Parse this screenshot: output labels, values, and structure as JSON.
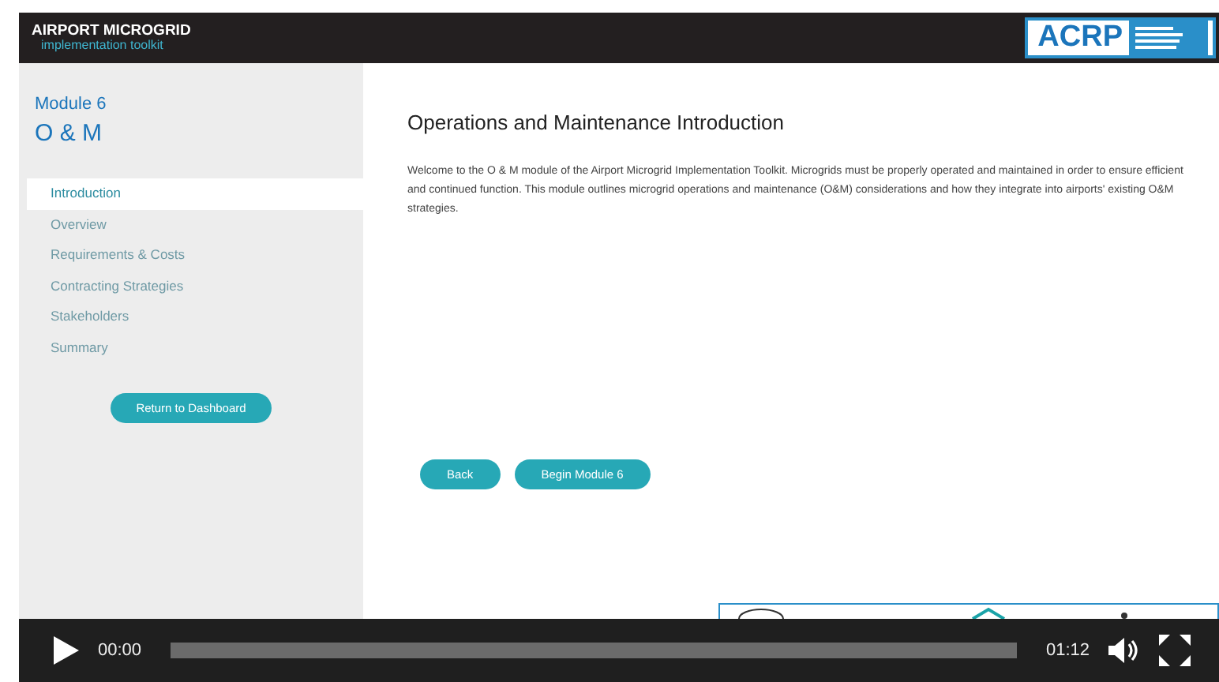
{
  "header": {
    "logo_title": "AIRPORT MICROGRID",
    "logo_subtitle": "implementation toolkit",
    "partner_logo": "ACRP"
  },
  "sidebar": {
    "module": "Module 6",
    "title": "O & M",
    "items": [
      {
        "label": "Introduction",
        "selected": true
      },
      {
        "label": "Overview",
        "selected": false
      },
      {
        "label": "Requirements & Costs",
        "selected": false
      },
      {
        "label": "Contracting Strategies",
        "selected": false
      },
      {
        "label": "Stakeholders",
        "selected": false
      },
      {
        "label": "Summary",
        "selected": false
      }
    ],
    "button": "Return to Dashboard"
  },
  "content": {
    "title": "Operations and Maintenance Introduction",
    "body": "Welcome to the O & M module of the Airport Microgrid Implementation Toolkit. Microgrids must be properly operated and maintained in order to ensure efficient and continued function. This module outlines microgrid operations and maintenance (O&M) considerations and how they integrate into airports' existing O&M strategies.",
    "buttons": [
      "Back",
      "Begin Module 6"
    ]
  },
  "player": {
    "current_time": "00:00",
    "duration": "01:12",
    "level": 0
  }
}
